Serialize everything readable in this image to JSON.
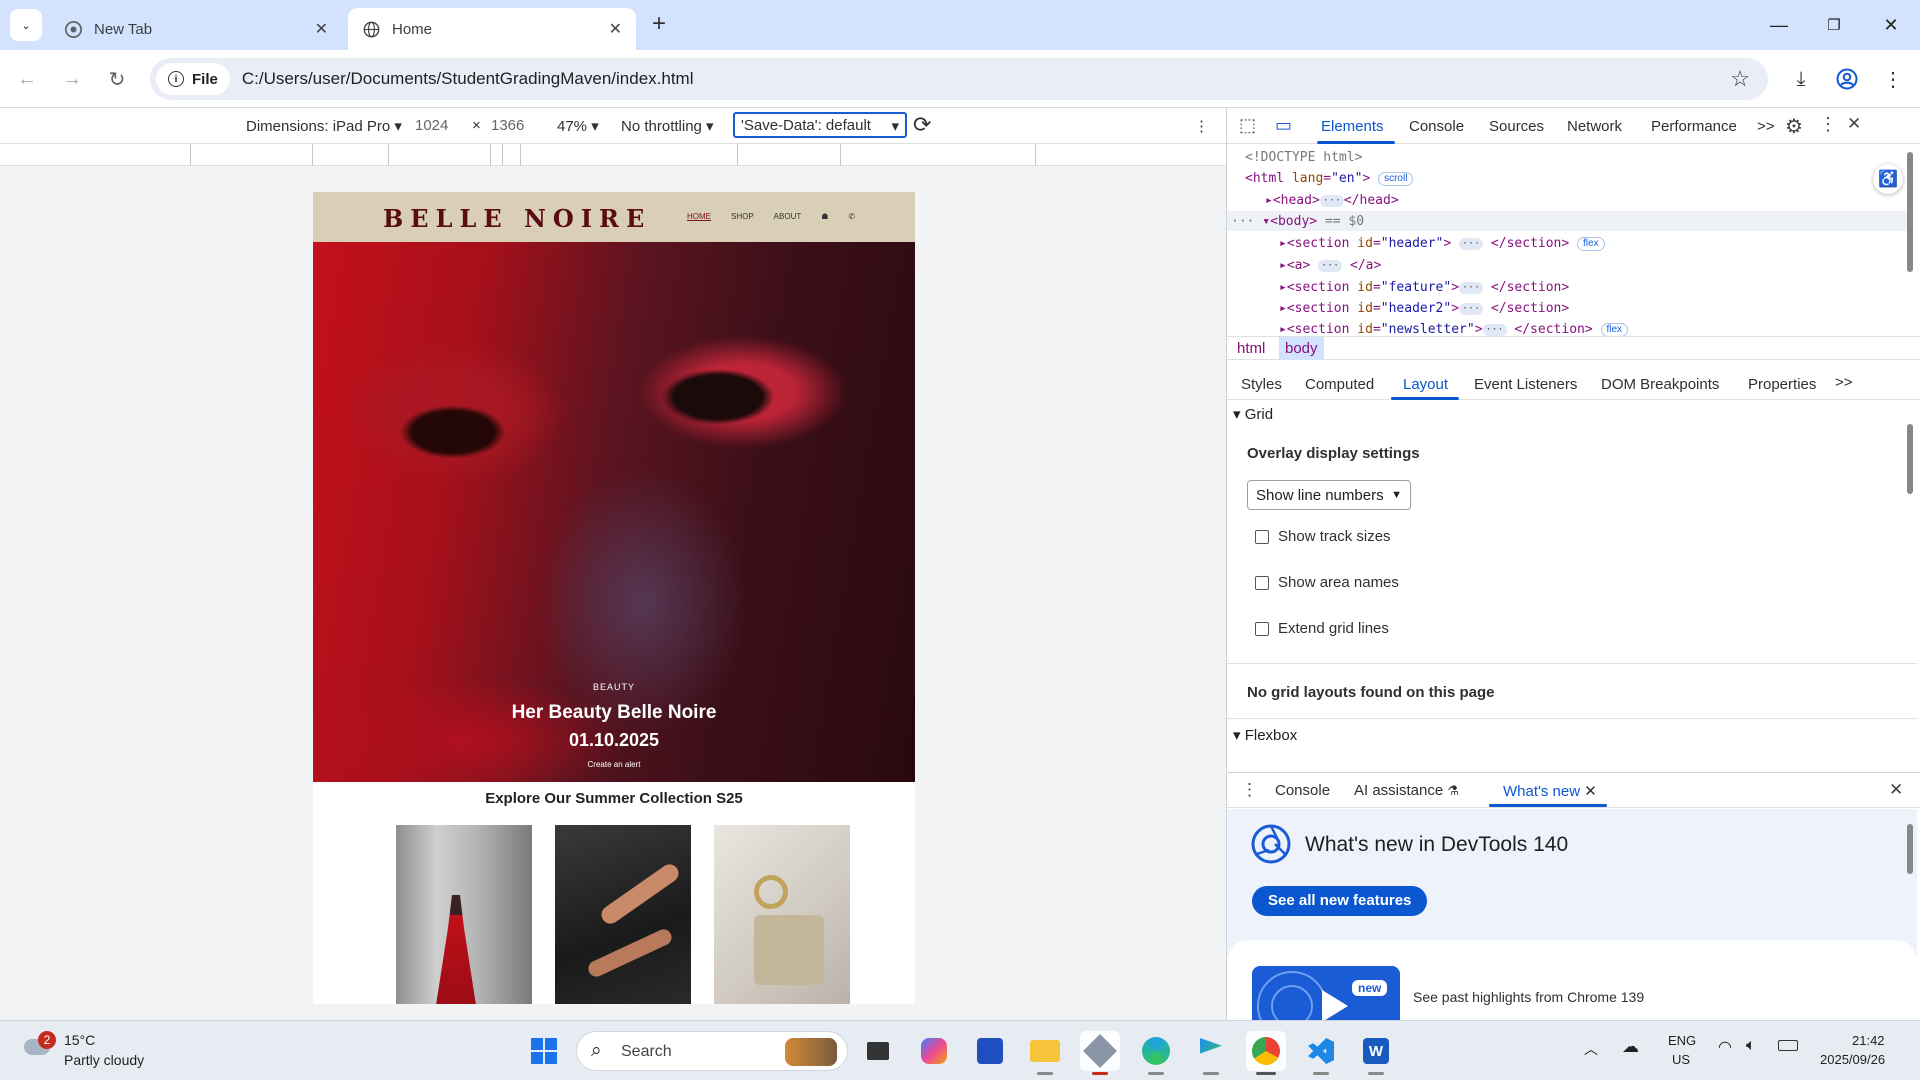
{
  "browser": {
    "tabs": [
      {
        "title": "New Tab",
        "active": false
      },
      {
        "title": "Home",
        "active": true
      }
    ],
    "new_tab_label": "+",
    "url_chip": "File",
    "url": "C:/Users/user/Documents/StudentGradingMaven/index.html"
  },
  "device_toolbar": {
    "dimensions_label": "Dimensions: iPad Pro",
    "width": "1024",
    "times": "×",
    "height": "1366",
    "zoom": "47%",
    "throttling": "No throttling",
    "save_data": "'Save-Data': default"
  },
  "site": {
    "logo": "BELLE NOIRE",
    "nav": [
      "HOME",
      "SHOP",
      "ABOUT",
      "☗",
      "✆"
    ],
    "hero_kicker": "BEAUTY",
    "hero_title": "Her Beauty Belle Noire",
    "hero_date": "01.10.2025",
    "hero_link": "Create an alert",
    "collection_title": "Explore Our Summer Collection S25"
  },
  "devtools": {
    "tabs": [
      "Elements",
      "Console",
      "Sources",
      "Network",
      "Performance"
    ],
    "more": ">>",
    "dom": {
      "doctype": "<!DOCTYPE html>",
      "html_open": "<html ",
      "html_attr": "lang",
      "html_val": "\"en\"",
      "html_close": ">",
      "scroll_badge": "scroll",
      "head": "<head>",
      "head_close": "</head>",
      "body": "<body>",
      "body_eq": " == $0",
      "rows": [
        {
          "tag": "<section ",
          "attr": "id",
          "val": "\"header\"",
          "end": "> ",
          "close": " </section>",
          "badge": "flex"
        },
        {
          "tag": "<a>",
          "attr": "",
          "val": "",
          "end": " ",
          "close": " </a>",
          "badge": ""
        },
        {
          "tag": "<section ",
          "attr": "id",
          "val": "\"feature\"",
          "end": ">",
          "close": " </section>",
          "badge": ""
        },
        {
          "tag": "<section ",
          "attr": "id",
          "val": "\"header2\"",
          "end": ">",
          "close": " </section>",
          "badge": ""
        },
        {
          "tag": "<section ",
          "attr": "id",
          "val": "\"newsletter\"",
          "end": ">",
          "close": " </section>",
          "badge": "flex"
        }
      ],
      "ellipsis": "···"
    },
    "breadcrumbs": [
      "html",
      "body"
    ],
    "subtabs": [
      "Styles",
      "Computed",
      "Layout",
      "Event Listeners",
      "DOM Breakpoints",
      "Properties"
    ],
    "layout": {
      "grid_heading": "Grid",
      "overlay_heading": "Overlay display settings",
      "select_value": "Show line numbers",
      "checkboxes": [
        "Show track sizes",
        "Show area names",
        "Extend grid lines"
      ],
      "no_grid": "No grid layouts found on this page",
      "flexbox_heading": "Flexbox"
    },
    "drawer": {
      "tabs": [
        "Console",
        "AI assistance",
        "What's new"
      ],
      "whats_new_title": "What's new in DevTools 140",
      "see_all": "See all new features",
      "new_badge": "new",
      "past": "See past highlights from Chrome 139"
    }
  },
  "taskbar": {
    "weather_badge": "2",
    "temperature": "15°C",
    "condition": "Partly cloudy",
    "search_placeholder": "Search",
    "lang1": "ENG",
    "lang2": "US",
    "time": "21:42",
    "date": "2025/09/26"
  },
  "colors": {
    "accent": "#0b57d0",
    "tabstrip": "#d3e3fd",
    "site_header": "#d8cfb6",
    "logo": "#5a0c12"
  }
}
